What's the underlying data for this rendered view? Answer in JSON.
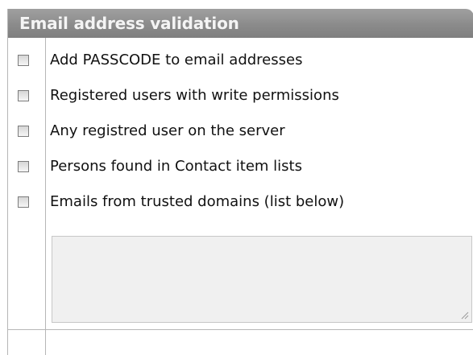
{
  "panel": {
    "title": "Email address validation"
  },
  "options": [
    {
      "label": "Add PASSCODE to email addresses",
      "checked": false
    },
    {
      "label": "Registered users with write permissions",
      "checked": false
    },
    {
      "label": "Any registred user on the server",
      "checked": false
    },
    {
      "label": "Persons found in Contact item lists",
      "checked": false
    },
    {
      "label": "Emails from trusted domains (list below)",
      "checked": false
    }
  ],
  "trusted_domains": {
    "value": ""
  },
  "colors": {
    "header_bg": "#8b8b8b",
    "header_text": "#f4f4f4",
    "border": "#b6b6b6",
    "textarea_bg": "#f0f0f0"
  },
  "icons": {
    "resize": "resize-grip-icon"
  }
}
